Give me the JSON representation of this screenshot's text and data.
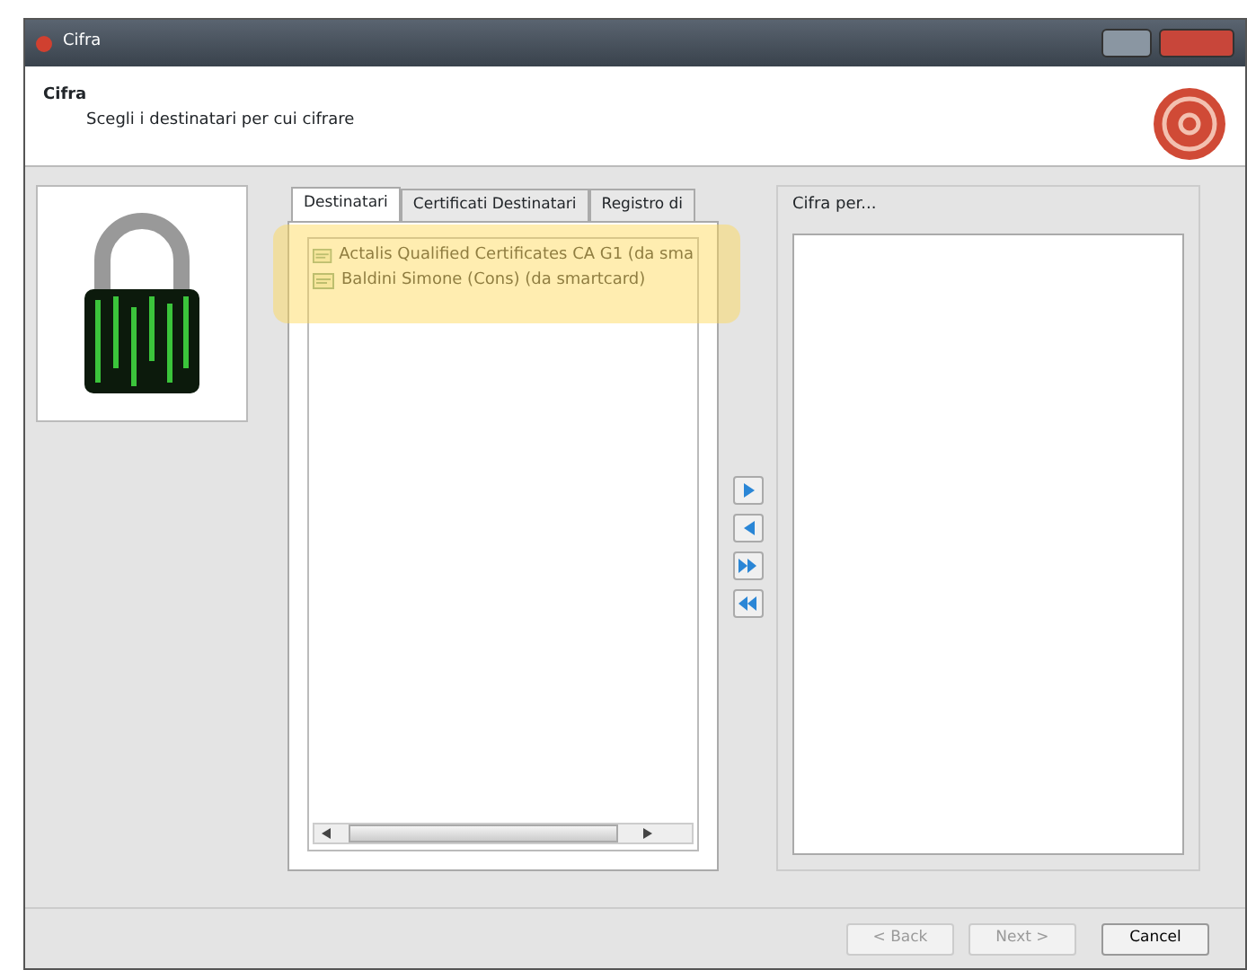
{
  "window": {
    "title": "Cifra"
  },
  "header": {
    "title": "Cifra",
    "subtitle": "Scegli i destinatari per cui cifrare"
  },
  "tabs": [
    {
      "label": "Destinatari",
      "selected": true
    },
    {
      "label": "Certificati Destinatari",
      "selected": false
    },
    {
      "label": "Registro di",
      "selected": false
    }
  ],
  "recipients": [
    {
      "label": "Actalis Qualified Certificates CA G1 (da sma"
    },
    {
      "label": "Baldini Simone (Cons) (da smartcard)"
    }
  ],
  "move_buttons": [
    {
      "kind": "add"
    },
    {
      "kind": "remove"
    },
    {
      "kind": "add-all"
    },
    {
      "kind": "remove-all"
    }
  ],
  "target_group": {
    "title": "Cifra per..."
  },
  "buttons": [
    {
      "label": "< Back",
      "disabled": true
    },
    {
      "label": "Next >",
      "disabled": true
    },
    {
      "label": "Cancel",
      "disabled": false
    }
  ]
}
